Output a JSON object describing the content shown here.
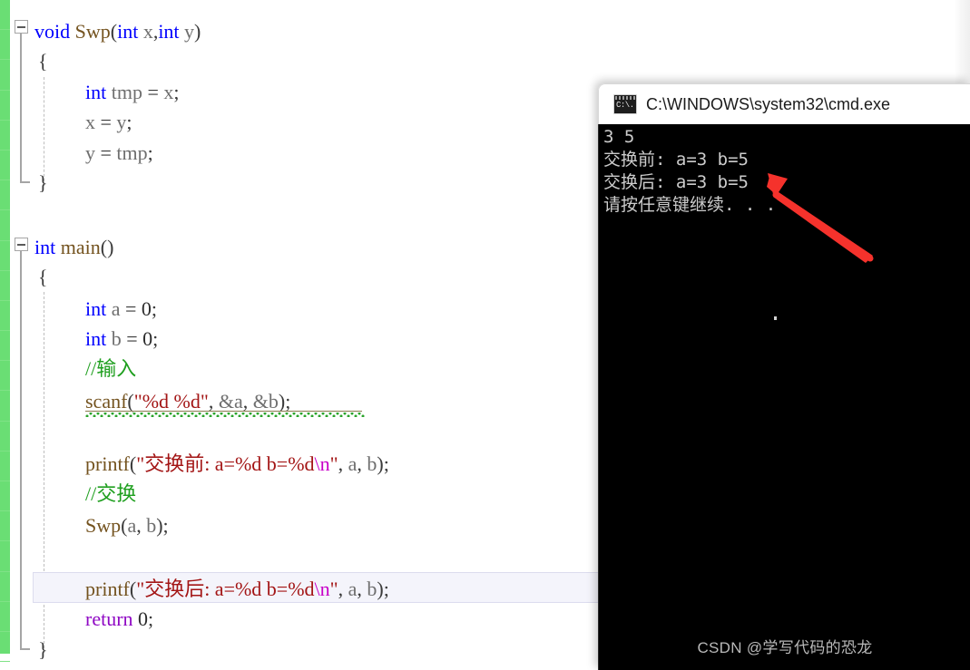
{
  "editor": {
    "name": "code-editor",
    "change_bar_color": "#6ade74",
    "current_line_index": 16,
    "code_lines": [
      {
        "indent": 0,
        "text": "void Swp(int x,int y)"
      },
      {
        "indent": 1,
        "text": "{"
      },
      {
        "indent": 2,
        "text": "int tmp = x;"
      },
      {
        "indent": 2,
        "text": "x = y;"
      },
      {
        "indent": 2,
        "text": "y = tmp;"
      },
      {
        "indent": 1,
        "text": "}"
      },
      {
        "indent": 0,
        "text": ""
      },
      {
        "indent": 0,
        "text": "int main()"
      },
      {
        "indent": 1,
        "text": "{"
      },
      {
        "indent": 2,
        "text": "int a = 0;"
      },
      {
        "indent": 2,
        "text": "int b = 0;"
      },
      {
        "indent": 2,
        "text": "//输入"
      },
      {
        "indent": 2,
        "text": "scanf(\"%d %d\", &a, &b);"
      },
      {
        "indent": 0,
        "text": ""
      },
      {
        "indent": 2,
        "text": "printf(\"交换前: a=%d b=%d\\n\", a, b);"
      },
      {
        "indent": 2,
        "text": "//交换"
      },
      {
        "indent": 2,
        "text": "Swp(a, b);"
      },
      {
        "indent": 0,
        "text": ""
      },
      {
        "indent": 2,
        "text": "printf(\"交换后: a=%d b=%d\\n\", a, b);"
      },
      {
        "indent": 2,
        "text": "return 0;"
      },
      {
        "indent": 1,
        "text": "}"
      }
    ],
    "tokens": {
      "t_void": "void",
      "t_swp": "Swp",
      "t_lparen": "(",
      "t_int": "int",
      "t_x": "x",
      "t_comma": ",",
      "t_y": "y",
      "t_rparen": ")",
      "t_obrace": "{",
      "t_cbrace": "}",
      "t_tmp": "tmp",
      "t_eq": "=",
      "t_semi": ";",
      "t_main": "main",
      "t_a": "a",
      "t_b": "b",
      "t_zero": "0",
      "t_comment_input": "//输入",
      "t_comment_swap": "//交换",
      "t_scanf": "scanf",
      "t_scanf_str": "\"%d %d\"",
      "t_amp_a": "&a",
      "t_amp_b": "&b",
      "t_printf": "printf",
      "t_printf_str_before": "\"交换前: a=%d b=%d",
      "t_printf_str_after": "\"交换后: a=%d b=%d",
      "t_escape_n": "\\n",
      "t_quote_close": "\"",
      "t_return": "return",
      "t_comma_sp": ", "
    }
  },
  "cmd_window": {
    "title": "C:\\WINDOWS\\system32\\cmd.exe",
    "icon": "cmd-console-icon",
    "icon_label": "C:\\.",
    "output_lines": [
      "3 5",
      "交换前: a=3 b=5",
      "交换后: a=3 b=5",
      "请按任意键继续. . ."
    ],
    "watermark": "CSDN @学写代码的恐龙",
    "background_color": "#000000",
    "text_color": "#cccccc"
  },
  "annotation": {
    "arrow_name": "red-pointer-arrow",
    "color": "#f5322c",
    "points_to": "交换后: a=3 b=5"
  }
}
